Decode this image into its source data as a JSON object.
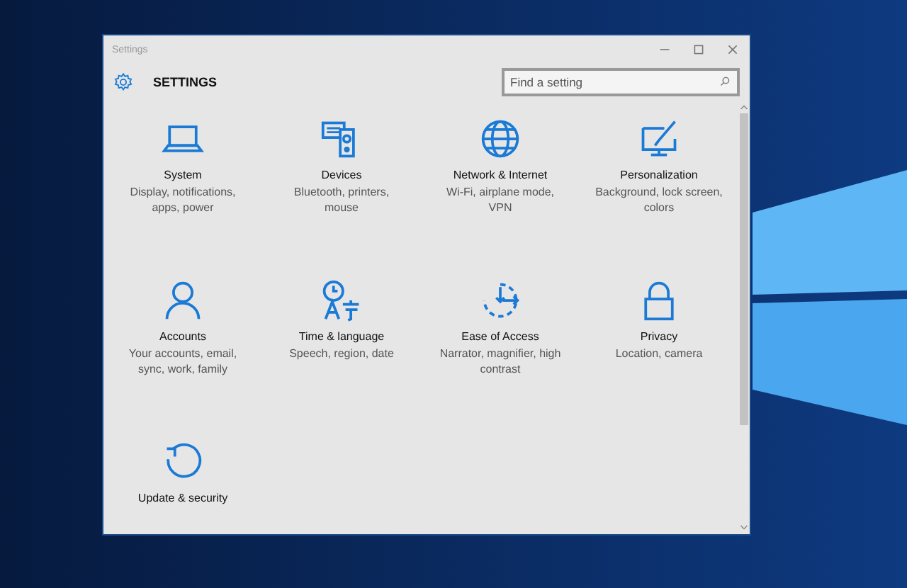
{
  "window": {
    "title": "Settings"
  },
  "header": {
    "title": "SETTINGS"
  },
  "search": {
    "placeholder": "Find a setting"
  },
  "categories": [
    {
      "title": "System",
      "description": "Display, notifications, apps, power"
    },
    {
      "title": "Devices",
      "description": "Bluetooth, printers, mouse"
    },
    {
      "title": "Network & Internet",
      "description": "Wi-Fi, airplane mode, VPN"
    },
    {
      "title": "Personalization",
      "description": "Background, lock screen, colors"
    },
    {
      "title": "Accounts",
      "description": "Your accounts, email, sync, work, family"
    },
    {
      "title": "Time & language",
      "description": "Speech, region, date"
    },
    {
      "title": "Ease of Access",
      "description": "Narrator, magnifier, high contrast"
    },
    {
      "title": "Privacy",
      "description": "Location, camera"
    },
    {
      "title": "Update & security"
    }
  ]
}
